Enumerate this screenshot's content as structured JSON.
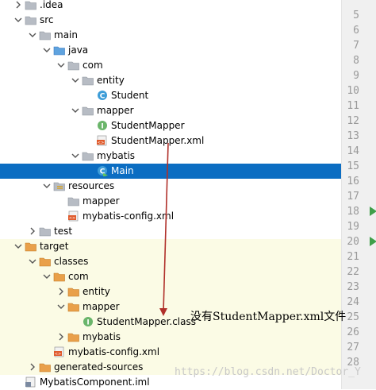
{
  "tree": [
    {
      "label": ".idea",
      "depth": 1,
      "arrow": "right",
      "icon": "folder-gray"
    },
    {
      "label": "src",
      "depth": 1,
      "arrow": "down",
      "icon": "folder-gray"
    },
    {
      "label": "main",
      "depth": 2,
      "arrow": "down",
      "icon": "folder-gray"
    },
    {
      "label": "java",
      "depth": 3,
      "arrow": "down",
      "icon": "folder-blue"
    },
    {
      "label": "com",
      "depth": 4,
      "arrow": "down",
      "icon": "folder-gray"
    },
    {
      "label": "entity",
      "depth": 5,
      "arrow": "down",
      "icon": "folder-gray"
    },
    {
      "label": "Student",
      "depth": 6,
      "arrow": "",
      "icon": "class"
    },
    {
      "label": "mapper",
      "depth": 5,
      "arrow": "down",
      "icon": "folder-gray"
    },
    {
      "label": "StudentMapper",
      "depth": 6,
      "arrow": "",
      "icon": "interface"
    },
    {
      "label": "StudentMapper.xml",
      "depth": 6,
      "arrow": "",
      "icon": "xml"
    },
    {
      "label": "mybatis",
      "depth": 5,
      "arrow": "down",
      "icon": "folder-gray"
    },
    {
      "label": "Main",
      "depth": 6,
      "arrow": "",
      "icon": "class-run",
      "selected": true
    },
    {
      "label": "resources",
      "depth": 3,
      "arrow": "down",
      "icon": "folder-resources"
    },
    {
      "label": "mapper",
      "depth": 4,
      "arrow": "",
      "icon": "folder-gray"
    },
    {
      "label": "mybatis-config.xml",
      "depth": 4,
      "arrow": "",
      "icon": "xml"
    },
    {
      "label": "test",
      "depth": 2,
      "arrow": "right",
      "icon": "folder-gray"
    },
    {
      "label": "target",
      "depth": 1,
      "arrow": "down",
      "icon": "folder-orange",
      "target": true
    },
    {
      "label": "classes",
      "depth": 2,
      "arrow": "down",
      "icon": "folder-orange",
      "target": true
    },
    {
      "label": "com",
      "depth": 3,
      "arrow": "down",
      "icon": "folder-orange",
      "target": true
    },
    {
      "label": "entity",
      "depth": 4,
      "arrow": "right",
      "icon": "folder-orange",
      "target": true
    },
    {
      "label": "mapper",
      "depth": 4,
      "arrow": "down",
      "icon": "folder-orange",
      "target": true
    },
    {
      "label": "StudentMapper.class",
      "depth": 5,
      "arrow": "",
      "icon": "interface",
      "target": true
    },
    {
      "label": "mybatis",
      "depth": 4,
      "arrow": "right",
      "icon": "folder-orange",
      "target": true
    },
    {
      "label": "mybatis-config.xml",
      "depth": 3,
      "arrow": "",
      "icon": "xml",
      "target": true
    },
    {
      "label": "generated-sources",
      "depth": 2,
      "arrow": "right",
      "icon": "folder-orange",
      "target": true
    },
    {
      "label": "MybatisComponent.iml",
      "depth": 1,
      "arrow": "",
      "icon": "iml"
    }
  ],
  "line_numbers": [
    "5",
    "6",
    "7",
    "8",
    "9",
    "10",
    "11",
    "12",
    "13",
    "14",
    "15",
    "16",
    "17",
    "18",
    "19",
    "20",
    "21",
    "22",
    "23",
    "24",
    "25",
    "26",
    "27",
    "28"
  ],
  "run_markers": [
    "18",
    "20"
  ],
  "note": "没有StudentMapper.xml文件",
  "watermark": "https://blog.csdn.net/Doctor_Y",
  "colors": {
    "selection": "#0b6dc2",
    "target_background": "#fbfbe5",
    "annotation_line": "#b0302a",
    "run_marker": "#3f9f4a"
  }
}
